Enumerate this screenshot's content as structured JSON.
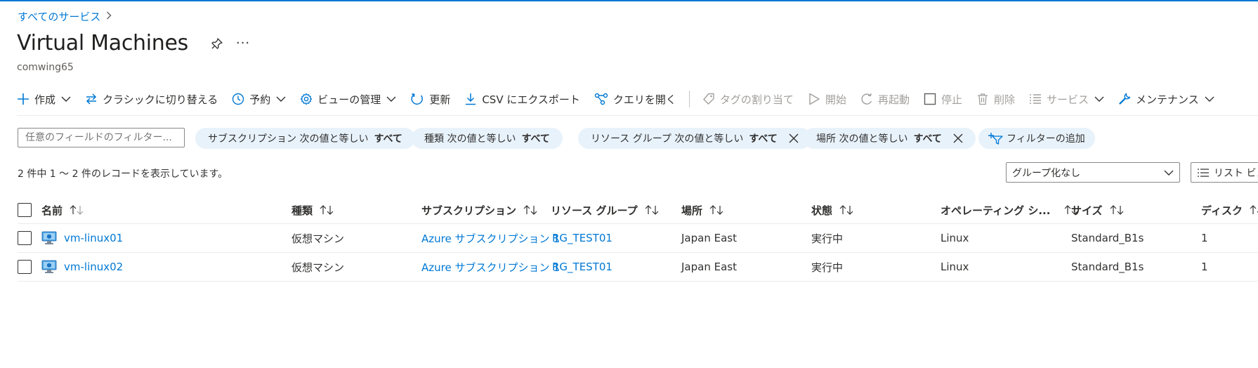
{
  "breadcrumb": {
    "label": "すべてのサービス"
  },
  "page": {
    "title": "Virtual Machines",
    "subtitle": "comwing65",
    "more": "···"
  },
  "toolbar": {
    "create": "作成",
    "switch_classic": "クラシックに切り替える",
    "reserve": "予約",
    "manage_view": "ビューの管理",
    "refresh": "更新",
    "export_csv": "CSV にエクスポート",
    "open_query": "クエリを開く",
    "assign_tags": "タグの割り当て",
    "start": "開始",
    "restart": "再起動",
    "stop": "停止",
    "delete": "削除",
    "services": "サービス",
    "maintenance": "メンテナンス"
  },
  "filters": {
    "search_placeholder": "任意のフィールドのフィルター...",
    "pills": [
      {
        "name": "サブスクリプション 次の値と等しい",
        "value": "すべて"
      },
      {
        "name": "種類 次の値と等しい",
        "value": "すべて"
      },
      {
        "name": "リソース グループ 次の値と等しい",
        "value": "すべて"
      },
      {
        "name": "場所 次の値と等しい",
        "value": "すべて"
      }
    ],
    "add_filter": "フィルターの追加"
  },
  "records_text": "2 件中 1 ～ 2 件のレコードを表示しています。",
  "groupby": {
    "selected": "グループ化なし"
  },
  "view_mode": {
    "label": "リスト ビュ"
  },
  "table": {
    "headers": {
      "name": "名前",
      "type": "種類",
      "subscription": "サブスクリプション",
      "resource_group": "リソース グループ",
      "location": "場所",
      "status": "状態",
      "os": "オペレーティング シ...",
      "size": "サイズ",
      "disks": "ディスク"
    },
    "rows": [
      {
        "name": "vm-linux01",
        "type": "仮想マシン",
        "subscription": "Azure サブスクリプション 1",
        "resource_group": "RG_TEST01",
        "location": "Japan East",
        "status": "実行中",
        "os": "Linux",
        "size": "Standard_B1s",
        "disks": "1"
      },
      {
        "name": "vm-linux02",
        "type": "仮想マシン",
        "subscription": "Azure サブスクリプション 1",
        "resource_group": "RG_TEST01",
        "location": "Japan East",
        "status": "実行中",
        "os": "Linux",
        "size": "Standard_B1s",
        "disks": "1"
      }
    ]
  },
  "colors": {
    "accent": "#0078d4",
    "pill_bg": "#e8f2fb",
    "disabled": "#a19f9d"
  }
}
